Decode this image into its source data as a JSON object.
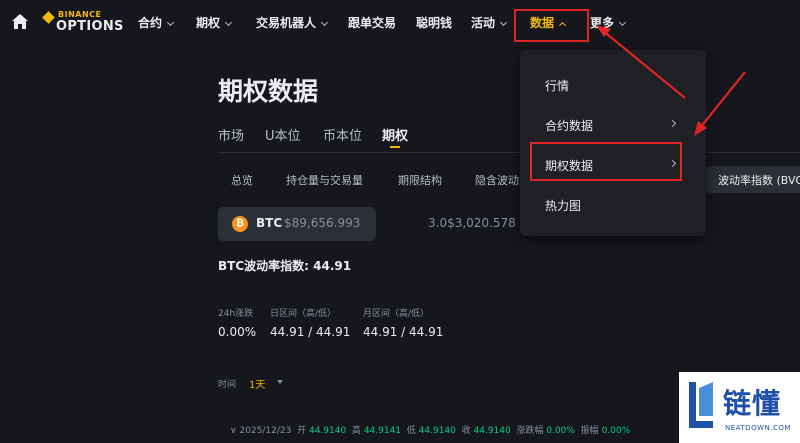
{
  "brand": {
    "top": "BINANCE",
    "bottom": "OPTIONS"
  },
  "nav": {
    "items": [
      {
        "label": "合约",
        "has_dropdown": true
      },
      {
        "label": "期权",
        "has_dropdown": true
      },
      {
        "label": "交易机器人",
        "has_dropdown": true
      },
      {
        "label": "跟单交易",
        "has_dropdown": false
      },
      {
        "label": "聪明钱",
        "has_dropdown": false
      },
      {
        "label": "活动",
        "has_dropdown": true
      },
      {
        "label": "数据",
        "has_dropdown": true,
        "active": true
      },
      {
        "label": "更多",
        "has_dropdown": true
      }
    ]
  },
  "dropdown": {
    "items": [
      {
        "label": "行情",
        "has_submenu": false
      },
      {
        "label": "合约数据",
        "has_submenu": true
      },
      {
        "label": "期权数据",
        "has_submenu": true,
        "highlighted": true
      },
      {
        "label": "热力图",
        "has_submenu": false
      }
    ]
  },
  "page": {
    "title": "期权数据",
    "tabs": [
      {
        "label": "市场",
        "active": false
      },
      {
        "label": "U本位",
        "active": false
      },
      {
        "label": "币本位",
        "active": false
      },
      {
        "label": "期权",
        "active": true
      }
    ],
    "subtabs": [
      {
        "label": "总览"
      },
      {
        "label": "持仓量与交易量"
      },
      {
        "label": "期限结构"
      },
      {
        "label": "隐含波动"
      },
      {
        "label": "波动率指数 (BVO"
      }
    ]
  },
  "ticker": {
    "btc_symbol": "BTC",
    "btc_price": "$89,656.993",
    "eth_fragment": "3.0$3,020.578"
  },
  "dvol": {
    "text": "BTC波动率指数: 44.91"
  },
  "stats": [
    {
      "label": "24h涨跌",
      "value": "0.00%"
    },
    {
      "label": "日区间（高/低）",
      "value": "44.91 / 44.91"
    },
    {
      "label": "月区间（高/低）",
      "value": "44.91 / 44.91"
    }
  ],
  "time": {
    "label": "时间",
    "value": "1天"
  },
  "ohlc": {
    "date": "2025/12/23",
    "open_label": "开",
    "open": "44.9140",
    "high_label": "高",
    "high": "44.9141",
    "low_label": "低",
    "low": "44.9140",
    "close_label": "收",
    "close": "44.9140",
    "change_label": "涨跌幅",
    "change": "0.00%",
    "amp_label": "振幅",
    "amp": "0.00%"
  },
  "watermark": {
    "big": "链懂",
    "small": "NEATDOWN.COM"
  },
  "colors": {
    "accent": "#f0b90b",
    "annotation": "#e02424",
    "up": "#0ecb81",
    "bg": "#16171c"
  }
}
